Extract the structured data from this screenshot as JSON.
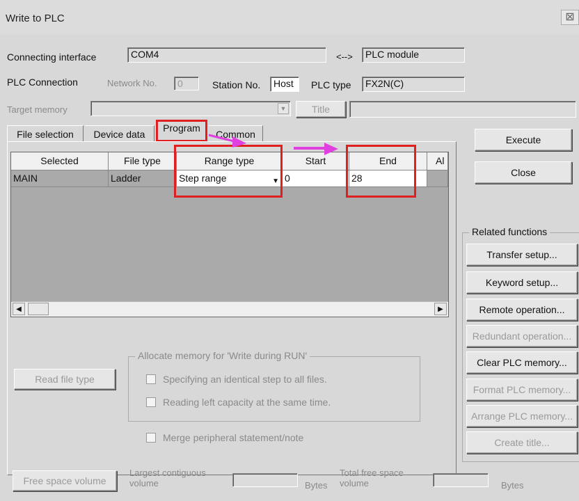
{
  "window": {
    "title": "Write to PLC",
    "close_glyph": "⊠"
  },
  "connection": {
    "interface_label": "Connecting interface",
    "interface_value": "COM4",
    "arrow": "<-->",
    "module_value": "PLC module",
    "plc_connection_label": "PLC Connection",
    "network_label": "Network No.",
    "network_value": "0",
    "station_label": "Station No.",
    "station_value": "Host",
    "plc_type_label": "PLC type",
    "plc_type_value": "FX2N(C)",
    "target_memory_label": "Target memory",
    "title_button": "Title"
  },
  "tabs": [
    "File selection",
    "Device data",
    "Program",
    "Common"
  ],
  "grid": {
    "headers": [
      "Selected",
      "File type",
      "Range type",
      "Start",
      "End",
      "Al"
    ],
    "row": {
      "selected": "MAIN",
      "file_type": "Ladder",
      "range_type": "Step range",
      "start": "0",
      "end": "28"
    }
  },
  "buttons": {
    "execute": "Execute",
    "close": "Close",
    "read_file_type": "Read file type",
    "free_space": "Free space volume"
  },
  "related": {
    "label": "Related functions",
    "items": [
      "Transfer setup...",
      "Keyword setup...",
      "Remote operation...",
      "Redundant operation...",
      "Clear PLC memory...",
      "Format PLC memory...",
      "Arrange PLC memory...",
      "Create title..."
    ],
    "enabled": [
      true,
      true,
      true,
      false,
      true,
      false,
      false,
      false
    ]
  },
  "allocate": {
    "label": "Allocate memory for 'Write during RUN'",
    "opt1": "Specifying an identical step to all files.",
    "opt2": "Reading left capacity at the same time.",
    "merge": "Merge peripheral statement/note"
  },
  "bottom": {
    "largest_label_1": "Largest contiguous",
    "largest_label_2": "volume",
    "bytes1": "Bytes",
    "total_label_1": "Total free space",
    "total_label_2": "volume",
    "bytes2": "Bytes"
  },
  "colors": {
    "highlight": "#e02020",
    "arrow": "#e040e0"
  }
}
